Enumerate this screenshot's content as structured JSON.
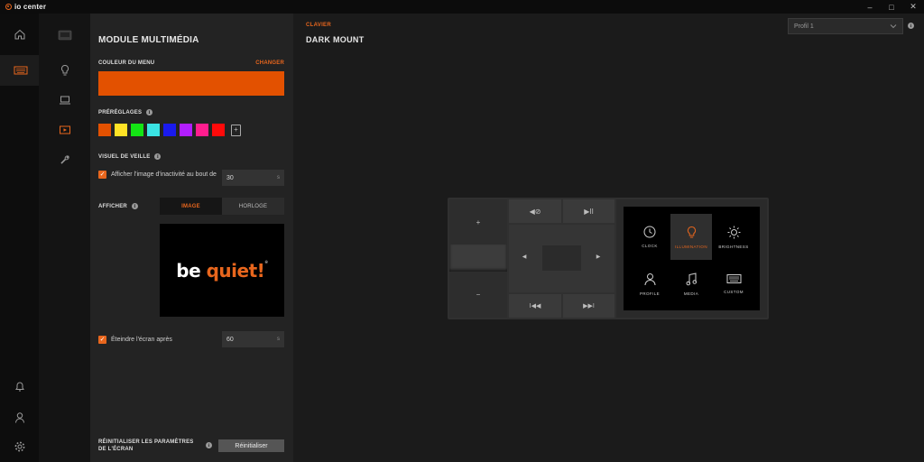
{
  "app": {
    "name": "io center"
  },
  "window_controls": [
    "–",
    "□",
    "✕"
  ],
  "panel": {
    "title": "MODULE MULTIMÉDIA",
    "menu_color_label": "COULEUR DU MENU",
    "change_label": "CHANGER",
    "menu_color": "#e35100",
    "presets_label": "PRÉRÉGLAGES",
    "presets": [
      "#e35100",
      "#ffe226",
      "#14e414",
      "#3ae3e3",
      "#1a1aee",
      "#b21eff",
      "#ff1d8e",
      "#ff0a0a"
    ],
    "standby_label": "VISUEL DE VEILLE",
    "inactivity_label": "Afficher l'image d'inactivité au bout de",
    "inactivity_value": "30",
    "inactivity_unit": "s",
    "show_label": "AFFICHER",
    "tabs": {
      "image": "IMAGE",
      "clock": "HORLOGE"
    },
    "logo_text_a": "be ",
    "logo_text_b": "quiet!",
    "logo_reg": "®",
    "screen_off_label": "Éteindre l'écran après",
    "screen_off_value": "60",
    "screen_off_unit": "s",
    "reset_label": "RÉINITIALISER LES PARAMÈTRES DE L'ÉCRAN",
    "reset_button": "Réinitialiser"
  },
  "main": {
    "category": "CLAVIER",
    "device_title": "DARK MOUNT",
    "profile_value": "Profil 1"
  },
  "device": {
    "plus": "+",
    "minus": "−",
    "mute": "◀⊘",
    "play_pause": "▶II",
    "left": "◀",
    "right": "▶",
    "prev": "I◀◀",
    "next": "▶▶I",
    "tiles": {
      "clock": "CLOCK",
      "illumination": "ILLUMINATION",
      "brightness": "BRIGHTNESS",
      "profile": "PROFILE",
      "media": "MEDIA",
      "custom": "CUSTOM"
    }
  },
  "colors": {
    "accent": "#e8661d"
  }
}
